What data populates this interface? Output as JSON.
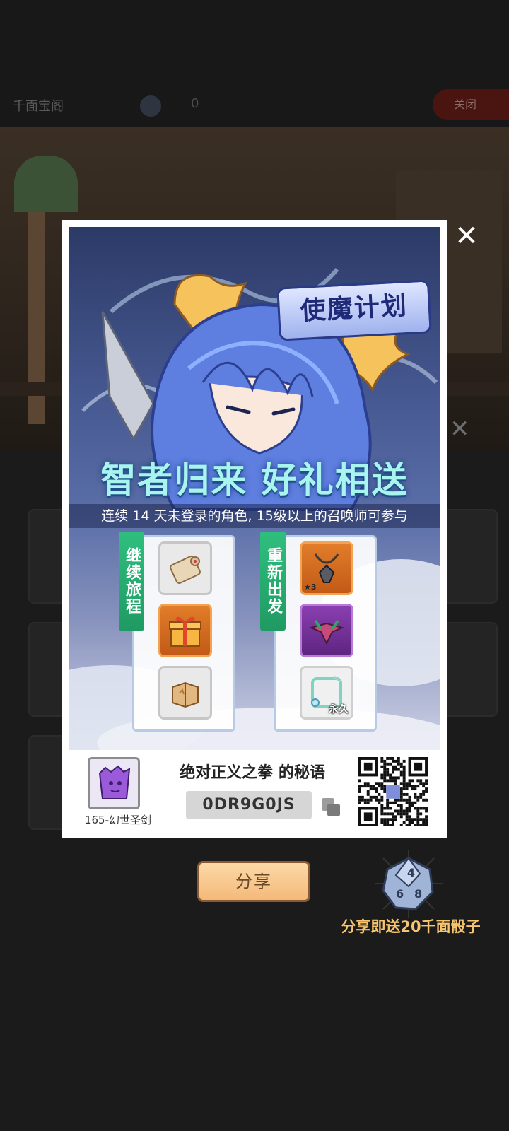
{
  "background": {
    "header_title": "千面宝阁",
    "coin_count": "0",
    "close_tab_label": "关闭"
  },
  "popup": {
    "logo_text": "使魔计划",
    "headline": "智者归来 好礼相送",
    "subtitle": "连续 14 天未登录的角色, 15级以上的召唤师可参与",
    "left_panel": {
      "ribbon": "继续旅程",
      "items": [
        "scroll-icon",
        "gift-box-icon",
        "book-icon"
      ]
    },
    "right_panel": {
      "ribbon": "重新出发",
      "items": [
        "necklace-icon",
        "crest-icon",
        "avatar-frame-icon"
      ],
      "item_badge_star": "★3",
      "item_badge_permanent": "永久"
    },
    "footer": {
      "avatar_caption": "165-幻世圣剑",
      "secret_title": "绝对正义之拳 的秘语",
      "code": "0DR9G0JS"
    }
  },
  "share_button_label": "分享",
  "dice_reward_text": "分享即送20千面骰子",
  "colors": {
    "headline": "#a7f5ee",
    "ribbon": "#2fbf7e",
    "share_button": "#f4b97a",
    "reward_text": "#f6c56e"
  }
}
